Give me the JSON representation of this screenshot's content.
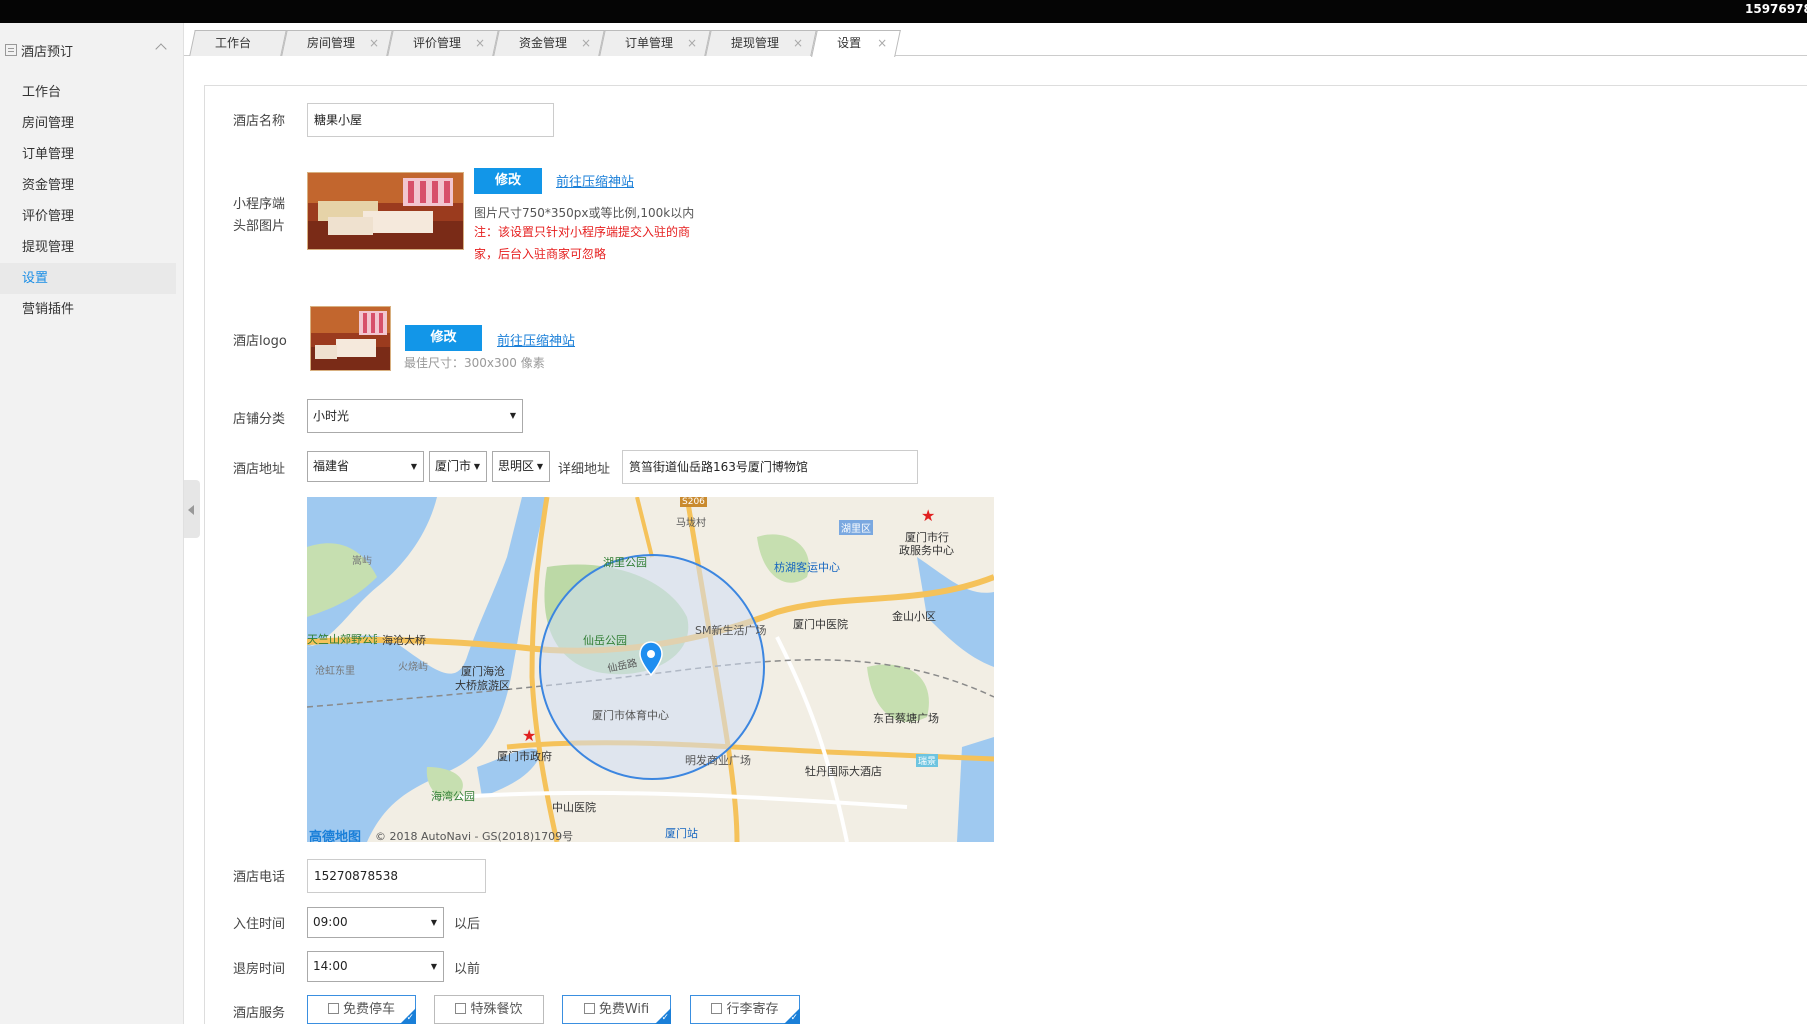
{
  "topbar": {
    "phone": "15976978"
  },
  "sidebar": {
    "group_title": "酒店预订",
    "items": [
      {
        "label": "工作台",
        "active": false
      },
      {
        "label": "房间管理",
        "active": false
      },
      {
        "label": "订单管理",
        "active": false
      },
      {
        "label": "资金管理",
        "active": false
      },
      {
        "label": "评价管理",
        "active": false
      },
      {
        "label": "提现管理",
        "active": false
      },
      {
        "label": "设置",
        "active": true
      },
      {
        "label": "营销插件",
        "active": false
      }
    ]
  },
  "tabs": [
    {
      "label": "工作台",
      "closable": false
    },
    {
      "label": "房间管理",
      "closable": true
    },
    {
      "label": "评价管理",
      "closable": true
    },
    {
      "label": "资金管理",
      "closable": true
    },
    {
      "label": "订单管理",
      "closable": true
    },
    {
      "label": "提现管理",
      "closable": true
    },
    {
      "label": "设置",
      "closable": true,
      "active": true
    }
  ],
  "tab_close_glyph": "×",
  "form": {
    "hotel_name": {
      "label": "酒店名称",
      "value": "糖果小屋"
    },
    "header_image": {
      "label_line1": "小程序端",
      "label_line2": "头部图片",
      "edit_button": "修改",
      "compress_link": "前往压缩神站",
      "size_desc": "图片尺寸750*350px或等比例,100k以内",
      "note_line1": "注：该设置只针对小程序端提交入驻的商",
      "note_line2": "家，后台入驻商家可忽略"
    },
    "hotel_logo": {
      "label": "酒店logo",
      "edit_button": "修改",
      "compress_link": "前往压缩神站",
      "hint": "最佳尺寸：300x300 像素"
    },
    "category": {
      "label": "店铺分类",
      "value": "小时光"
    },
    "address": {
      "label": "酒店地址",
      "province": "福建省",
      "city": "厦门市",
      "district": "思明区",
      "detail_label": "详细地址",
      "detail_value": "筼筜街道仙岳路163号厦门博物馆"
    },
    "map": {
      "labels": [
        "湖里公园",
        "枋湖客运中心",
        "厦门市行",
        "政服务中心",
        "湖里区",
        "马垅村",
        "仙岳公园",
        "SM新生活广场",
        "厦门中医院",
        "金山小区",
        "海沧大桥",
        "厦门海沧",
        "大桥旅游区",
        "厦门市体育中心",
        "东百蔡塘广场",
        "厦门市政府",
        "明发商业广场",
        "牡丹国际大酒店",
        "海湾公园",
        "中山医院",
        "厦门站",
        "仙岳路",
        "嵩屿",
        "沧虹东里",
        "火烧屿",
        "天竺山郊野公园",
        "S206",
        "瑞景"
      ],
      "copyright": "© 2018 AutoNavi - GS(2018)1709号",
      "brand": "高德地图"
    },
    "phone": {
      "label": "酒店电话",
      "value": "15270878538"
    },
    "checkin": {
      "label": "入住时间",
      "value": "09:00",
      "suffix": "以后"
    },
    "checkout": {
      "label": "退房时间",
      "value": "14:00",
      "suffix": "以前"
    },
    "services": {
      "label": "酒店服务",
      "items": [
        {
          "label": "免费停车",
          "selected": true,
          "icon": "parking-icon"
        },
        {
          "label": "特殊餐饮",
          "selected": false,
          "icon": "dining-icon"
        },
        {
          "label": "免费Wifi",
          "selected": true,
          "icon": "wifi-icon"
        },
        {
          "label": "行李寄存",
          "selected": true,
          "icon": "luggage-icon"
        }
      ]
    }
  },
  "colors": {
    "accent": "#1296e8",
    "active_nav": "#1a8ee6",
    "note_red": "#e62020",
    "topbar": "#050505"
  }
}
